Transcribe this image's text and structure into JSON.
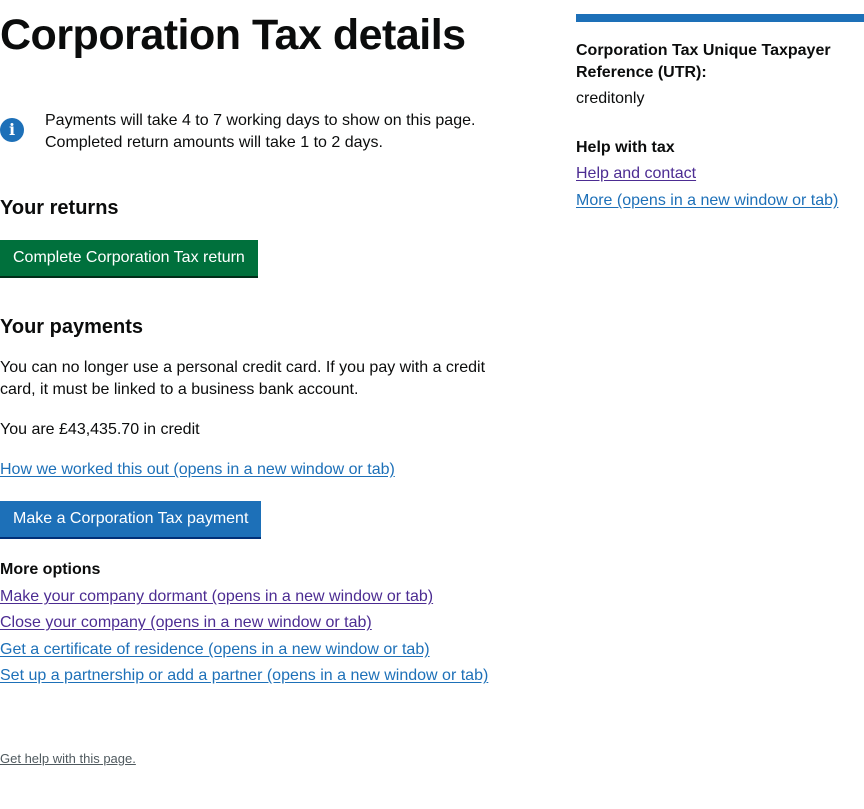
{
  "page": {
    "title": "Corporation Tax details"
  },
  "notice": {
    "icon": "info-icon",
    "line1": "Payments will take 4 to 7 working days to show on this page.",
    "line2": "Completed return amounts will take 1 to 2 days."
  },
  "returns": {
    "heading": "Your returns",
    "button_label": "Complete Corporation Tax return"
  },
  "payments": {
    "heading": "Your payments",
    "credit_card_notice": "You can no longer use a personal credit card. If you pay with a credit card, it must be linked to a business bank account.",
    "credit_status": "You are £43,435.70 in credit",
    "how_link": "How we worked this out (opens in a new window or tab)",
    "button_label": "Make a Corporation Tax payment"
  },
  "more_options": {
    "heading": "More options",
    "links": [
      "Make your company dormant (opens in a new window or tab)",
      "Close your company (opens in a new window or tab)",
      "Get a certificate of residence (opens in a new window or tab)",
      "Set up a partnership or add a partner (opens in a new window or tab)"
    ]
  },
  "footer": {
    "help_link": "Get help with this page."
  },
  "sidebar": {
    "utr_title": "Corporation Tax Unique Taxpayer Reference (UTR):",
    "utr_value": "creditonly",
    "help_title": "Help with tax",
    "help_link": "Help and contact",
    "more_link": "More (opens in a new window or tab)"
  },
  "colors": {
    "link": "#1d70b8",
    "visited_link": "#4c2c92",
    "green_button": "#00703c",
    "blue_button": "#1d70b8",
    "text": "#0b0c0c"
  }
}
